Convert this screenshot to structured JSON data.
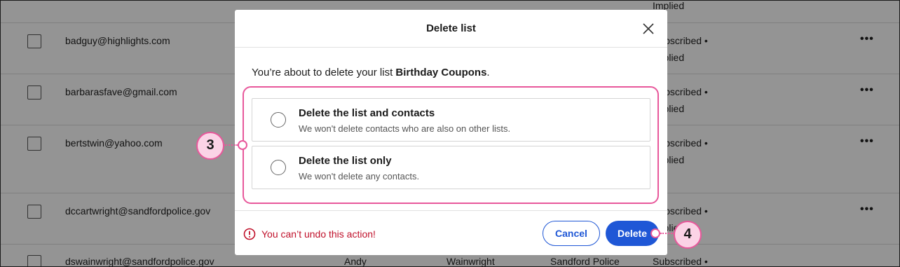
{
  "background_table": {
    "rows": [
      {
        "email": "",
        "first_name": "",
        "last_name": "",
        "company": "",
        "status_line1": "",
        "status_line2": "Implied"
      },
      {
        "email": "badguy@highlights.com",
        "first_name": "",
        "last_name": "",
        "company": "",
        "status_line1": "Subscribed •",
        "status_line2": "Implied"
      },
      {
        "email": "barbarasfave@gmail.com",
        "first_name": "",
        "last_name": "",
        "company": "",
        "status_line1": "Subscribed •",
        "status_line2": "Implied"
      },
      {
        "email": "bertstwin@yahoo.com",
        "first_name": "",
        "last_name": "",
        "company": "",
        "status_line1": "Subscribed •",
        "status_line2": "Implied"
      },
      {
        "email": "dccartwright@sandfordpolice.gov",
        "first_name": "",
        "last_name": "",
        "company": "",
        "status_line1": "Subscribed •",
        "status_line2": "Implied"
      },
      {
        "email": "dswainwright@sandfordpolice.gov",
        "first_name": "Andy",
        "last_name": "Wainwright",
        "company": "Sandford Police",
        "status_line1": "Subscribed •",
        "status_line2": ""
      }
    ],
    "more_glyph": "•••"
  },
  "modal": {
    "title": "Delete list",
    "intro_prefix": "You’re about to delete your list ",
    "list_name": "Birthday Coupons",
    "intro_suffix": ".",
    "options": [
      {
        "title": "Delete the list and contacts",
        "subtitle": "We won't delete contacts who are also on other lists."
      },
      {
        "title": "Delete the list only",
        "subtitle": "We won't delete any contacts."
      }
    ],
    "warning": "You can’t undo this action!",
    "cancel_label": "Cancel",
    "delete_label": "Delete"
  },
  "callouts": {
    "options_callout": "3",
    "delete_callout": "4"
  },
  "colors": {
    "accent_blue": "#1f57d6",
    "warning_red": "#c0102a",
    "callout_pink": "#e8589b",
    "callout_fill": "#fbd3e6"
  }
}
